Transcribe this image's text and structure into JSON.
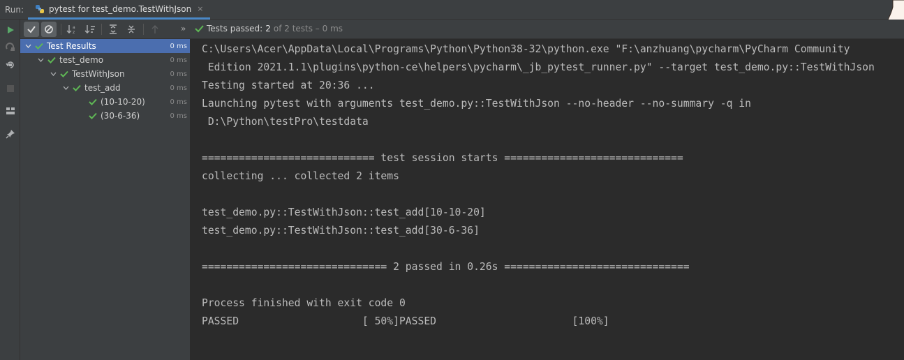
{
  "tabbar": {
    "run_label": "Run:",
    "tab_title": "pytest for test_demo.TestWithJson",
    "close_glyph": "×"
  },
  "toolbar": {
    "more_glyph": "»",
    "status_passed_label": "Tests passed:",
    "status_count": "2",
    "status_rest": "of 2 tests – 0 ms"
  },
  "tree": {
    "rows": [
      {
        "label": "Test Results",
        "duration": "0 ms",
        "selected": true
      },
      {
        "label": "test_demo",
        "duration": "0 ms"
      },
      {
        "label": "TestWithJson",
        "duration": "0 ms"
      },
      {
        "label": "test_add",
        "duration": "0 ms"
      },
      {
        "label": "(10-10-20)",
        "duration": "0 ms"
      },
      {
        "label": "(30-6-36)",
        "duration": "0 ms"
      }
    ]
  },
  "console": {
    "lines": [
      "C:\\Users\\Acer\\AppData\\Local\\Programs\\Python\\Python38-32\\python.exe \"F:\\anzhuang\\pycharm\\PyCharm Community",
      " Edition 2021.1.1\\plugins\\python-ce\\helpers\\pycharm\\_jb_pytest_runner.py\" --target test_demo.py::TestWithJson",
      "Testing started at 20:36 ...",
      "Launching pytest with arguments test_demo.py::TestWithJson --no-header --no-summary -q in",
      " D:\\Python\\testPro\\testdata",
      "",
      "============================ test session starts =============================",
      "collecting ... collected 2 items",
      "",
      "test_demo.py::TestWithJson::test_add[10-10-20]",
      "test_demo.py::TestWithJson::test_add[30-6-36]",
      "",
      "============================== 2 passed in 0.26s ==============================",
      "",
      "Process finished with exit code 0",
      "PASSED                    [ 50%]PASSED                      [100%]"
    ]
  },
  "colors": {
    "pass_green": "#5fb855",
    "selection_blue": "#4b6eaf",
    "tab_underline": "#4a88c7"
  },
  "icons": {
    "left_strip": [
      "run-icon",
      "rerun-failed-icon",
      "rerun-icon",
      "stop-icon",
      "layout-icon",
      "pin-icon"
    ],
    "toolbar": [
      "show-passed-icon",
      "show-ignored-icon",
      "sort-alphabetically-icon",
      "sort-by-duration-icon",
      "expand-all-icon",
      "collapse-all-icon",
      "previous-failed-icon"
    ]
  }
}
